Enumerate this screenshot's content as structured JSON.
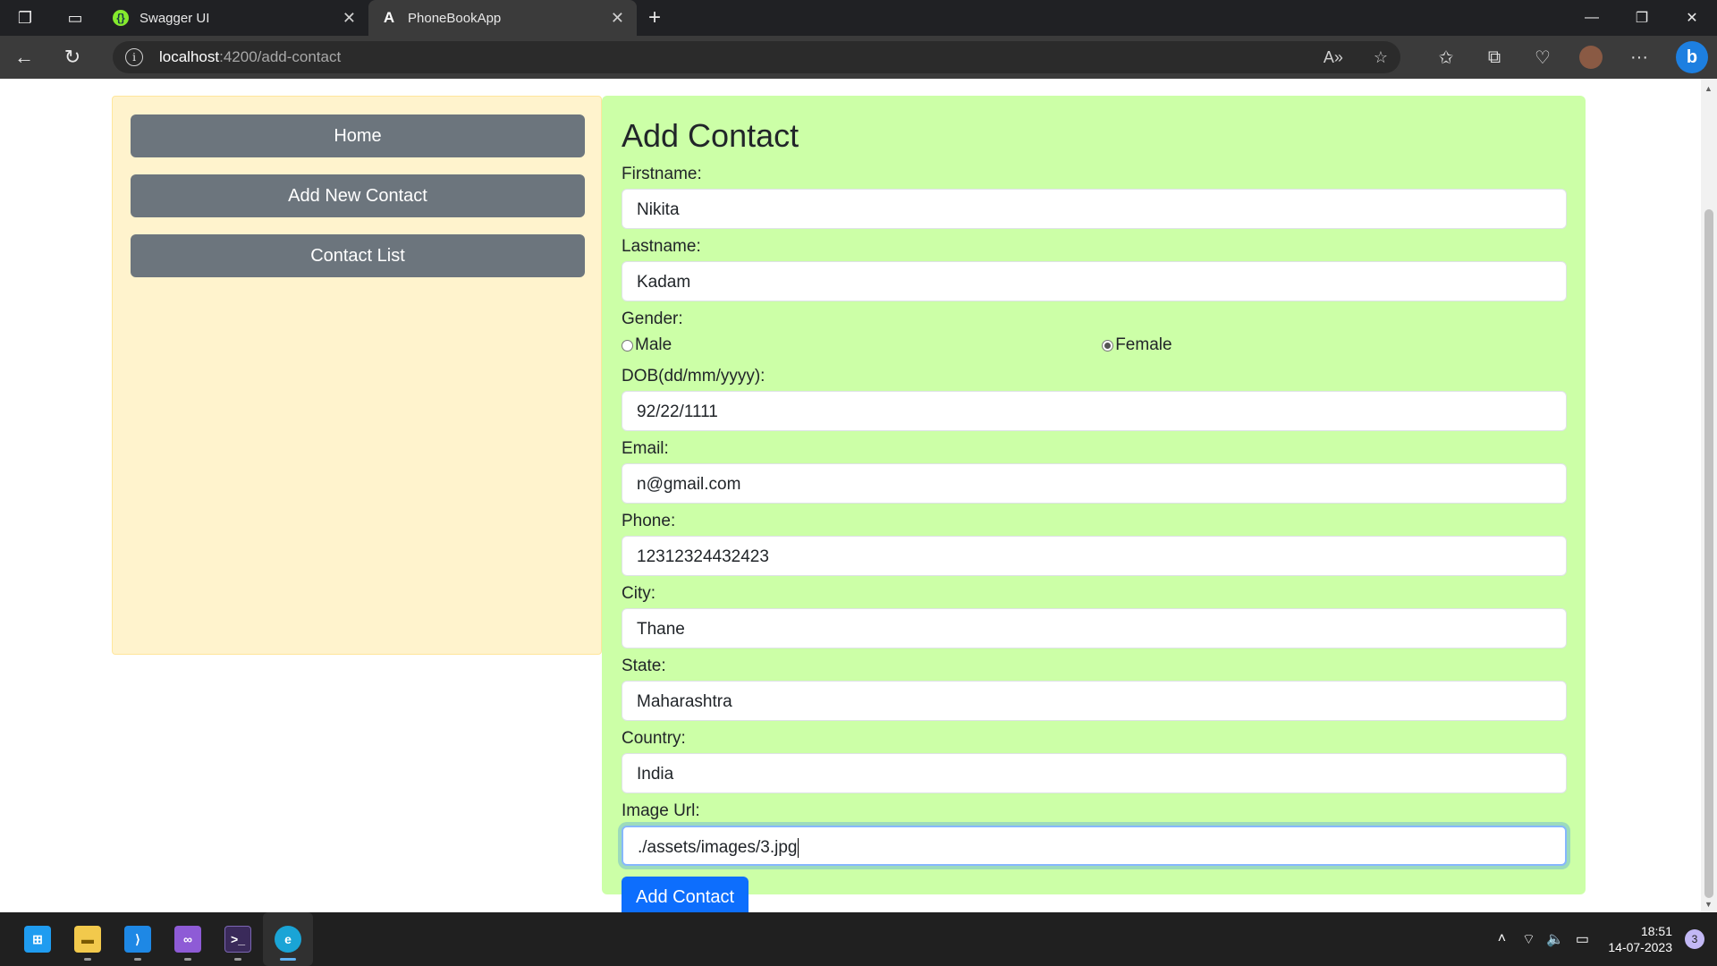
{
  "browser": {
    "tabs": [
      {
        "title": "Swagger UI",
        "active": false
      },
      {
        "title": "PhoneBookApp",
        "active": true
      }
    ],
    "address": {
      "host": "localhost",
      "path": ":4200/add-contact"
    }
  },
  "sidebar": {
    "buttons": [
      {
        "label": "Home"
      },
      {
        "label": "Add New Contact"
      },
      {
        "label": "Contact List"
      }
    ]
  },
  "form": {
    "title": "Add Contact",
    "firstname": {
      "label": "Firstname:",
      "value": "Nikita"
    },
    "lastname": {
      "label": "Lastname:",
      "value": "Kadam"
    },
    "gender": {
      "label": "Gender:",
      "options": [
        "Male",
        "Female"
      ],
      "selected": "Female"
    },
    "dob": {
      "label": "DOB(dd/mm/yyyy):",
      "value": "92/22/1111"
    },
    "email": {
      "label": "Email:",
      "value": "n@gmail.com"
    },
    "phone": {
      "label": "Phone:",
      "value": "12312324432423"
    },
    "city": {
      "label": "City:",
      "value": "Thane"
    },
    "state": {
      "label": "State:",
      "value": "Maharashtra"
    },
    "country": {
      "label": "Country:",
      "value": "India"
    },
    "image_url": {
      "label": "Image Url:",
      "value": "./assets/images/3.jpg"
    },
    "submit_label": "Add Contact"
  },
  "taskbar": {
    "time": "18:51",
    "date": "14-07-2023",
    "notifications": "3"
  },
  "colors": {
    "sidebar_bg": "#fff3cd",
    "form_bg": "#ccffa7",
    "sidebar_button": "#6c757d",
    "primary_button": "#0d6efd"
  }
}
